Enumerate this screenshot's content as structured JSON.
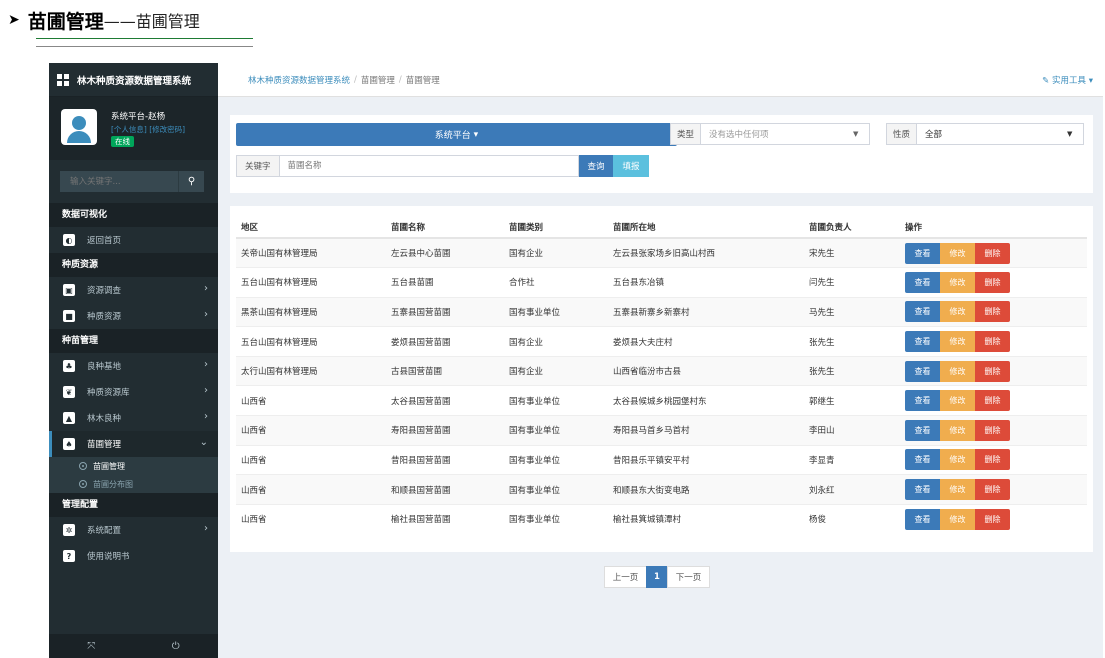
{
  "doc": {
    "arrow": "➤",
    "title_main": "苗圃管理",
    "title_sub": "——苗圃管理"
  },
  "app": {
    "logo": "林木种质资源数据管理系统"
  },
  "user": {
    "name": "系统平台-赵杨",
    "link_info": "[个人信息]",
    "link_pwd": "[修改密码]",
    "status": "在线"
  },
  "sidebar": {
    "search_placeholder": "输入关键字...",
    "sections": {
      "viz": "数据可视化",
      "germ": "种质资源",
      "seed": "种苗管理",
      "admin": "管理配置"
    },
    "items": {
      "home": "返回首页",
      "survey": "资源调查",
      "germplasm": "种质资源",
      "base": "良种基地",
      "library": "种质资源库",
      "fine": "林木良种",
      "nursery": "苗圃管理",
      "sub_manage": "苗圃管理",
      "sub_map": "苗圃分布图",
      "config": "系统配置",
      "manual": "使用说明书"
    }
  },
  "breadcrumb": {
    "home": "林木种质资源数据管理系统",
    "level1": "苗圃管理",
    "level2": "苗圃管理"
  },
  "tools": "实用工具",
  "filters": {
    "platform": "系统平台",
    "type_label": "类型",
    "type_value": "没有选中任何项",
    "nature_label": "性质",
    "nature_value": "全部",
    "keyword_label": "关键字",
    "keyword_placeholder": "苗圃名称",
    "query": "查询",
    "add": "填报"
  },
  "table": {
    "headers": [
      "地区",
      "苗圃名称",
      "苗圃类别",
      "苗圃所在地",
      "苗圃负责人",
      "操作"
    ],
    "rows": [
      [
        "关帝山国有林管理局",
        "左云县中心苗圃",
        "国有企业",
        "左云县张家场乡旧高山村西",
        "宋先生"
      ],
      [
        "五台山国有林管理局",
        "五台县苗圃",
        "合作社",
        "五台县东冶镇",
        "闫先生"
      ],
      [
        "黑茶山国有林管理局",
        "五寨县国营苗圃",
        "国有事业单位",
        "五寨县新寨乡新寨村",
        "马先生"
      ],
      [
        "五台山国有林管理局",
        "娄烦县国营苗圃",
        "国有企业",
        "娄烦县大夫庄村",
        "张先生"
      ],
      [
        "太行山国有林管理局",
        "古县国营苗圃",
        "国有企业",
        "山西省临汾市古县",
        "张先生"
      ],
      [
        "山西省",
        "太谷县国营苗圃",
        "国有事业单位",
        "太谷县候城乡桃园堡村东",
        "郭继生"
      ],
      [
        "山西省",
        "寿阳县国营苗圃",
        "国有事业单位",
        "寿阳县马首乡马首村",
        "李田山"
      ],
      [
        "山西省",
        "昔阳县国营苗圃",
        "国有事业单位",
        "昔阳县乐平镇安平村",
        "李显青"
      ],
      [
        "山西省",
        "和顺县国营苗圃",
        "国有事业单位",
        "和顺县东大街变电路",
        "刘永红"
      ],
      [
        "山西省",
        "榆社县国营苗圃",
        "国有事业单位",
        "榆社县箕城镇潭村",
        "杨俊"
      ]
    ],
    "actions": {
      "view": "查看",
      "edit": "修改",
      "del": "删除"
    }
  },
  "pager": {
    "prev": "上一页",
    "current": "1",
    "next": "下一页"
  }
}
